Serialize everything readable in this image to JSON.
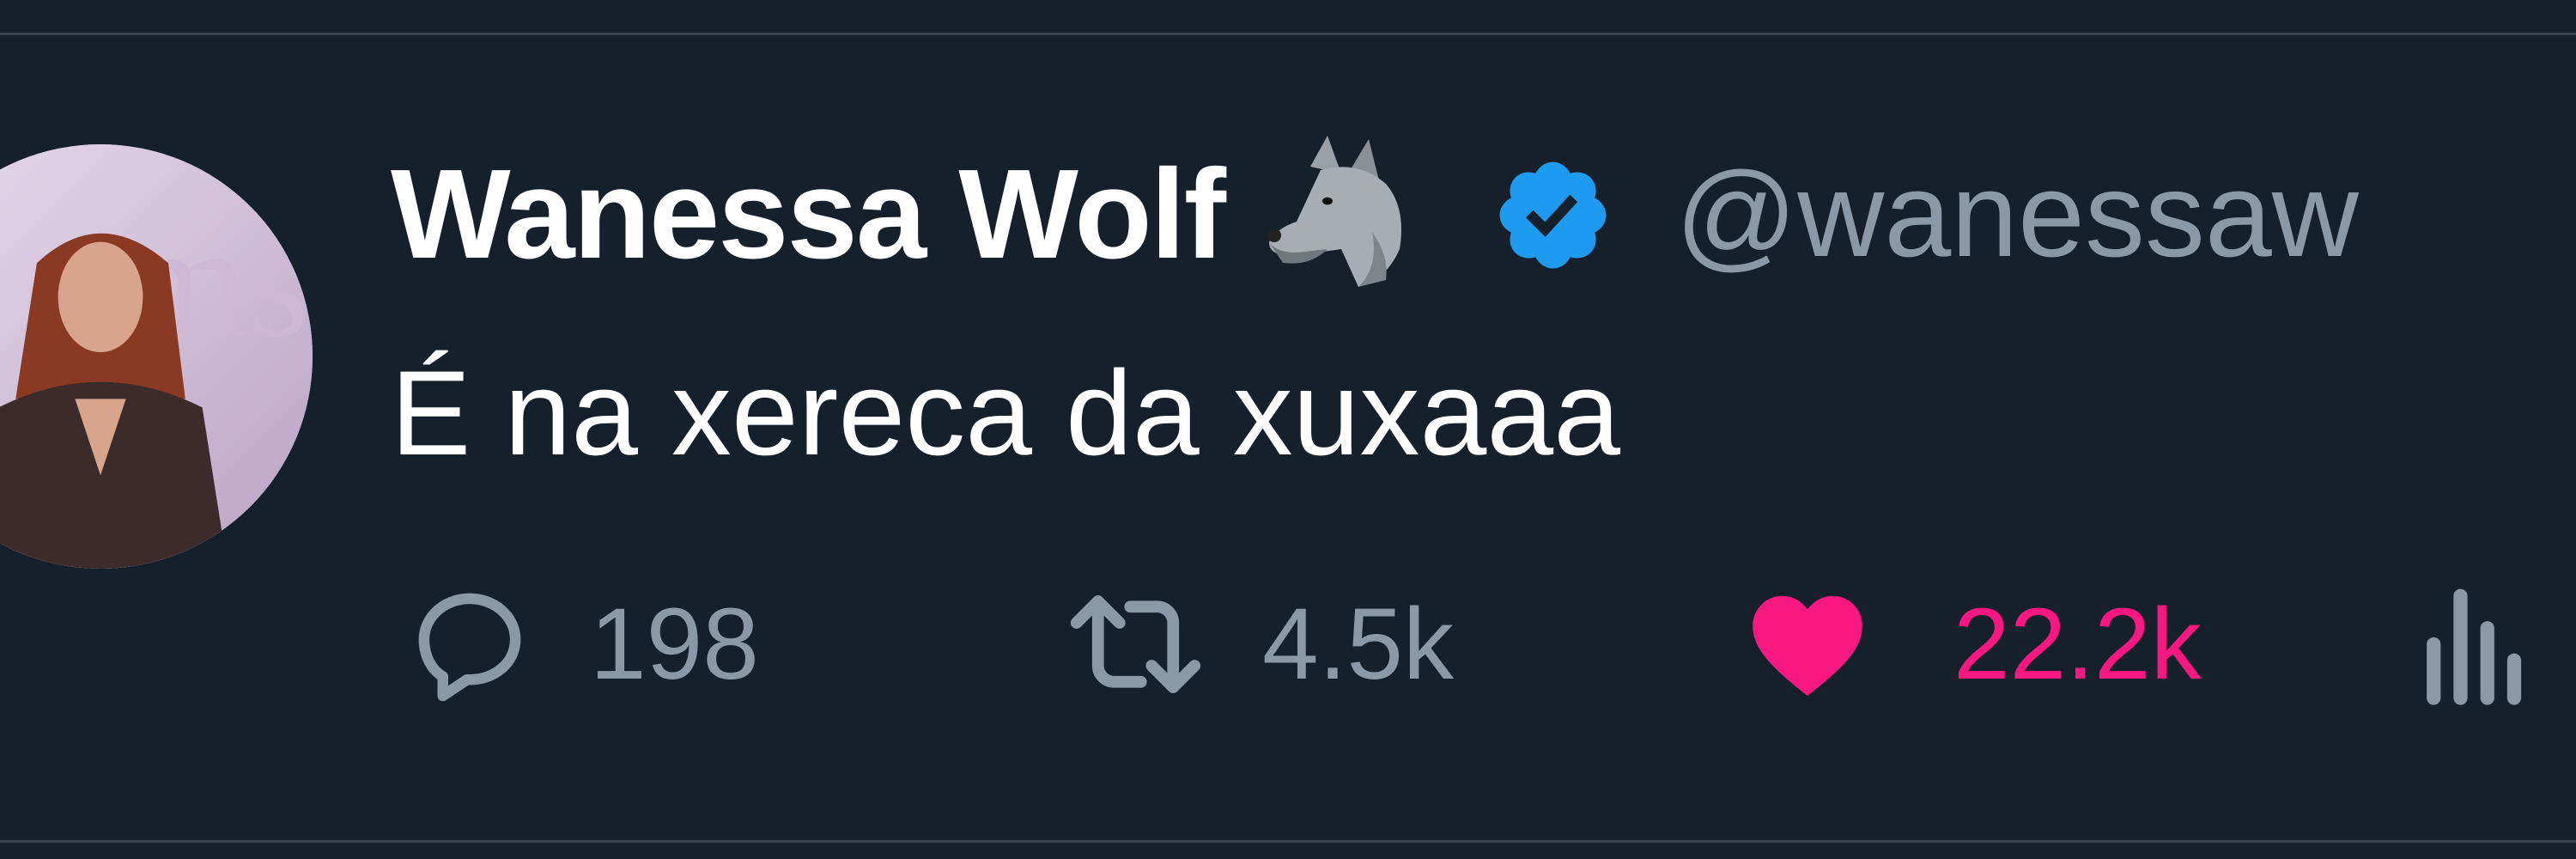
{
  "tweet": {
    "author": {
      "display_name": "Wanessa Wolf",
      "name_emoji_icon": "wolf-face-icon",
      "verified_icon": "verified-badge-icon",
      "handle": "@wanessaw"
    },
    "text": "É na xereca da xuxaaa",
    "actions": {
      "reply": {
        "icon": "reply-icon",
        "count": "198"
      },
      "retweet": {
        "icon": "retweet-icon",
        "count": "4.5k"
      },
      "like": {
        "icon": "heart-icon",
        "count": "22.2k",
        "active": true
      },
      "views": {
        "icon": "views-icon"
      }
    }
  },
  "colors": {
    "background": "#15202b",
    "divider": "#38444d",
    "primary_text": "#ffffff",
    "secondary_text": "#8b98a5",
    "verified_blue": "#1d9bf0",
    "like_pink": "#f91880"
  }
}
